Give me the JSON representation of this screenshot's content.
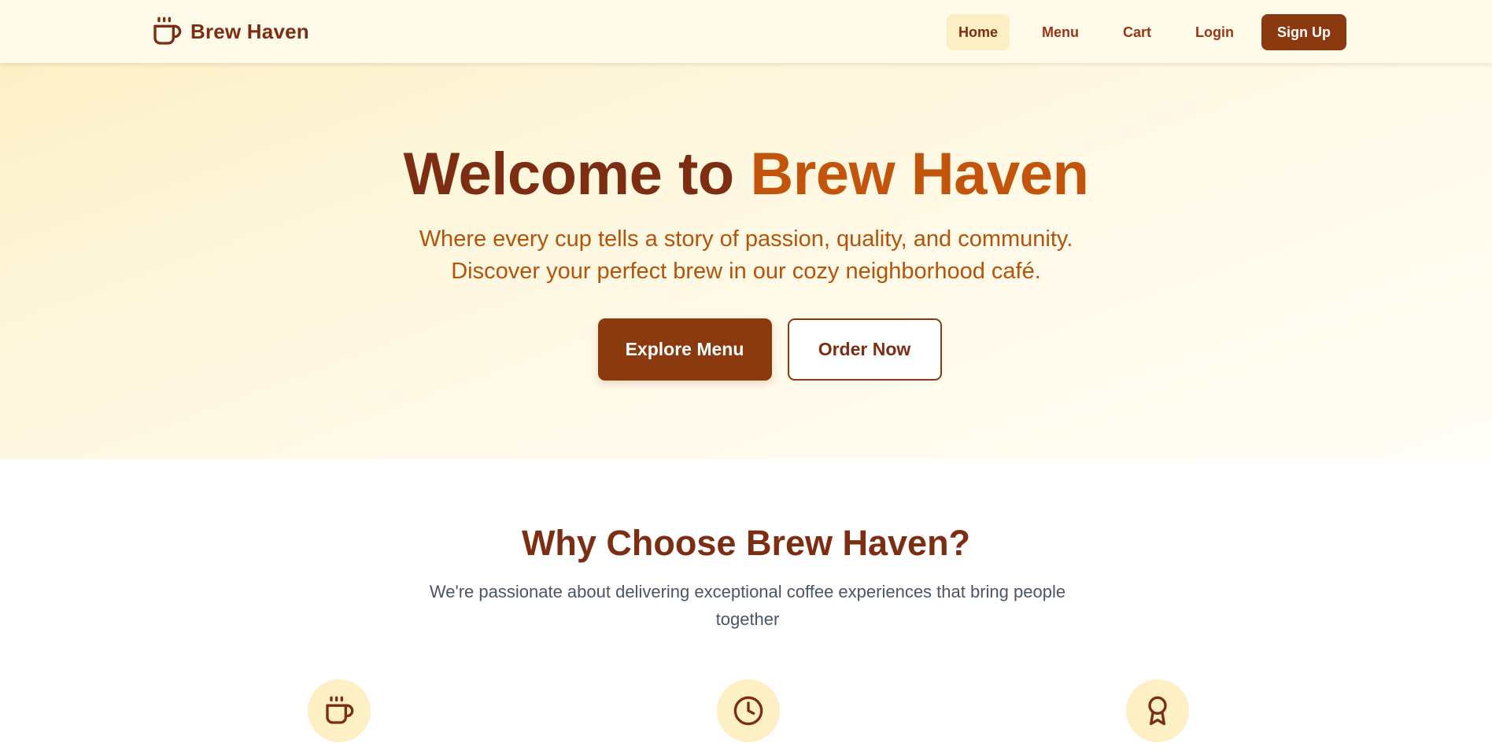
{
  "brand": {
    "name": "Brew Haven",
    "icon": "coffee-cup-icon"
  },
  "nav": {
    "items": [
      {
        "label": "Home",
        "active": true
      },
      {
        "label": "Menu",
        "active": false
      },
      {
        "label": "Cart",
        "active": false
      },
      {
        "label": "Login",
        "active": false
      }
    ],
    "signup_label": "Sign Up"
  },
  "hero": {
    "title_prefix": "Welcome to ",
    "title_accent": "Brew Haven",
    "subtitle_line1": "Where every cup tells a story of passion, quality, and community.",
    "subtitle_line2": "Discover your perfect brew in our cozy neighborhood café.",
    "primary_button": "Explore Menu",
    "secondary_button": "Order Now"
  },
  "features": {
    "title": "Why Choose Brew Haven?",
    "subtitle_line1": "We're passionate about delivering exceptional coffee experiences that bring people",
    "subtitle_line2": "together",
    "icons": [
      "coffee-cup-icon",
      "clock-icon",
      "award-icon"
    ]
  },
  "colors": {
    "primary": "#8b3a0f",
    "heading": "#7c2d12",
    "accent": "#c2540c",
    "nav_bg": "#fffbeb",
    "icon_bg": "#fdf0c4"
  }
}
